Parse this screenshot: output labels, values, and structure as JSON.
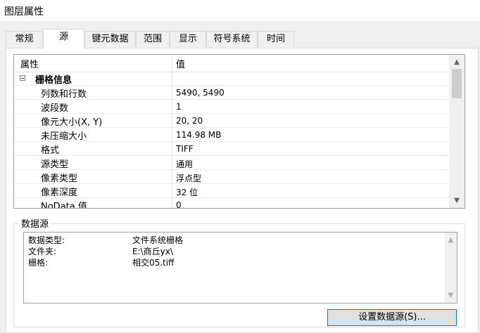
{
  "window": {
    "title": "图层属性"
  },
  "tabs": [
    {
      "label": "常规"
    },
    {
      "label": "源"
    },
    {
      "label": "键元数据"
    },
    {
      "label": "范围"
    },
    {
      "label": "显示"
    },
    {
      "label": "符号系统"
    },
    {
      "label": "时间"
    }
  ],
  "active_tab": "源",
  "properties": {
    "header": {
      "property": "属性",
      "value": "值"
    },
    "group": {
      "label": "栅格信息",
      "expanded": true
    },
    "rows": [
      {
        "key": "列数和行数",
        "value": "5490, 5490"
      },
      {
        "key": "波段数",
        "value": "1"
      },
      {
        "key": "像元大小(X, Y)",
        "value": "20, 20"
      },
      {
        "key": "未压缩大小",
        "value": "114.98 MB"
      },
      {
        "key": "格式",
        "value": "TIFF"
      },
      {
        "key": "源类型",
        "value": "通用"
      },
      {
        "key": "像素类型",
        "value": "浮点型"
      },
      {
        "key": "像素深度",
        "value": "32 位"
      },
      {
        "key": "NoData 值",
        "value": "0"
      }
    ]
  },
  "datasource": {
    "group_label": "数据源",
    "lines": [
      {
        "key": "数据类型:",
        "value": "文件系统栅格"
      },
      {
        "key": "文件夹:",
        "value": "E:\\商丘yx\\"
      },
      {
        "key": "栅格:",
        "value": "相交05.tiff"
      }
    ],
    "button_label": "设置数据源(S)..."
  },
  "icons": {
    "expander": "collapse-minus-icon",
    "scroll_up": "chevron-up-icon",
    "scroll_down": "chevron-down-icon"
  }
}
